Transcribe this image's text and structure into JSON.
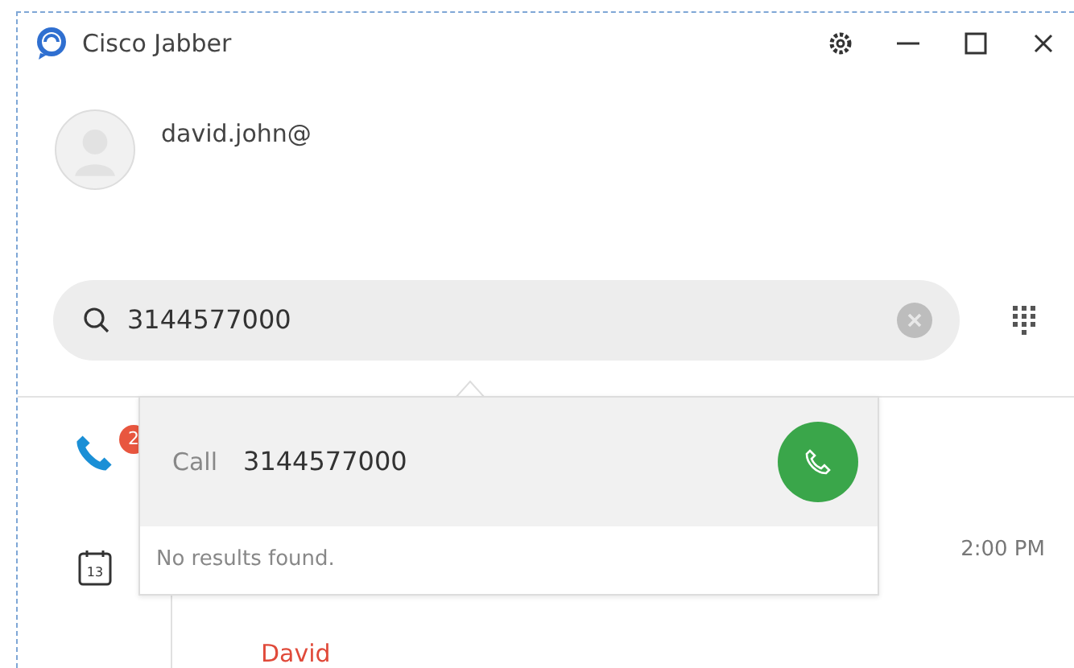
{
  "window": {
    "title": "Cisco Jabber"
  },
  "user": {
    "name": "david.john@"
  },
  "search": {
    "value": "3144577000"
  },
  "rail": [
    {
      "kind": "calls",
      "badge": "2"
    },
    {
      "kind": "meetings",
      "badge": "13"
    }
  ],
  "popup": {
    "call_label": "Call",
    "number": "3144577000",
    "message": "No results found."
  },
  "meeting": {
    "time": "2:00 PM",
    "name": "David"
  }
}
